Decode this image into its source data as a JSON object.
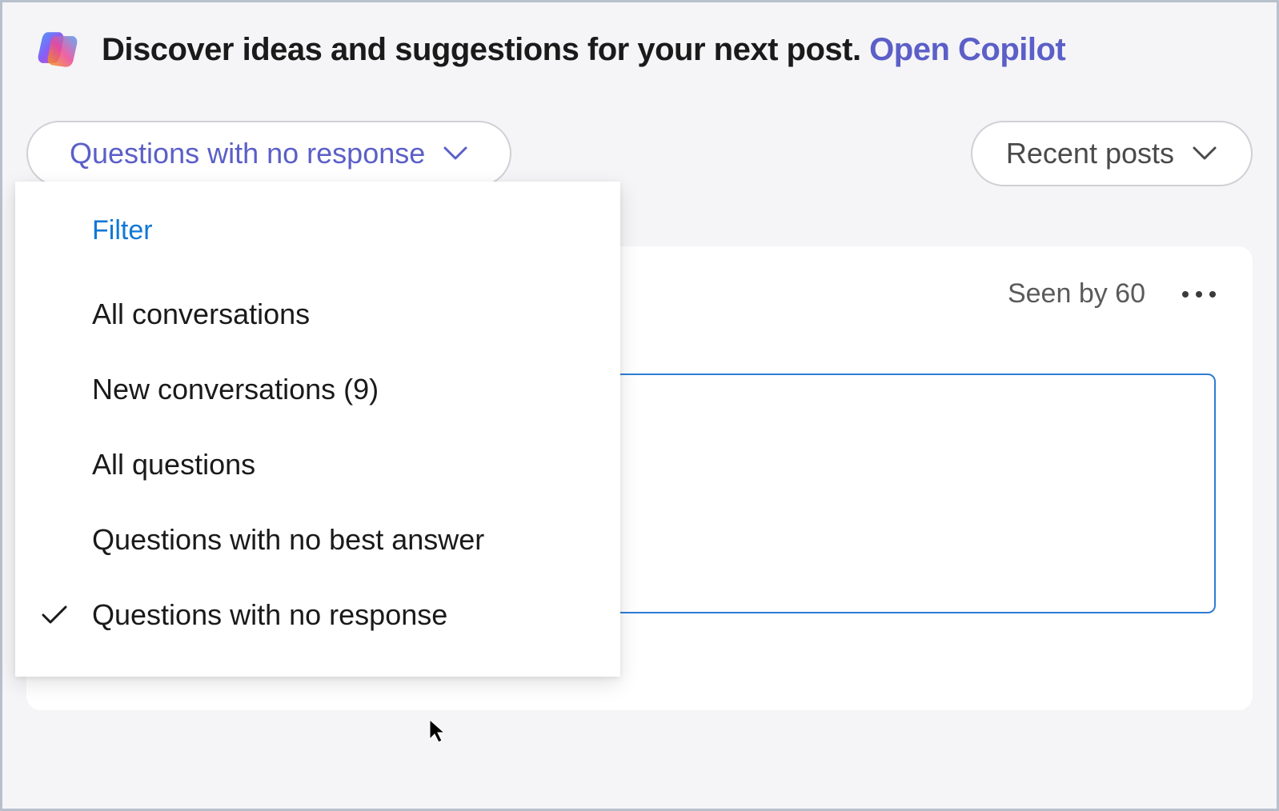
{
  "banner": {
    "text": "Discover ideas and suggestions for your next post. ",
    "link_text": "Open Copilot"
  },
  "filter_dropdown": {
    "selected_label": "Questions with no response",
    "header": "Filter",
    "items": [
      {
        "label": "All conversations",
        "selected": false
      },
      {
        "label": "New conversations (9)",
        "selected": false
      },
      {
        "label": "All questions",
        "selected": false
      },
      {
        "label": "Questions with no best answer",
        "selected": false
      },
      {
        "label": "Questions with no response",
        "selected": true
      }
    ]
  },
  "sort_dropdown": {
    "selected_label": "Recent posts"
  },
  "post": {
    "seen_text": "Seen by 60"
  }
}
